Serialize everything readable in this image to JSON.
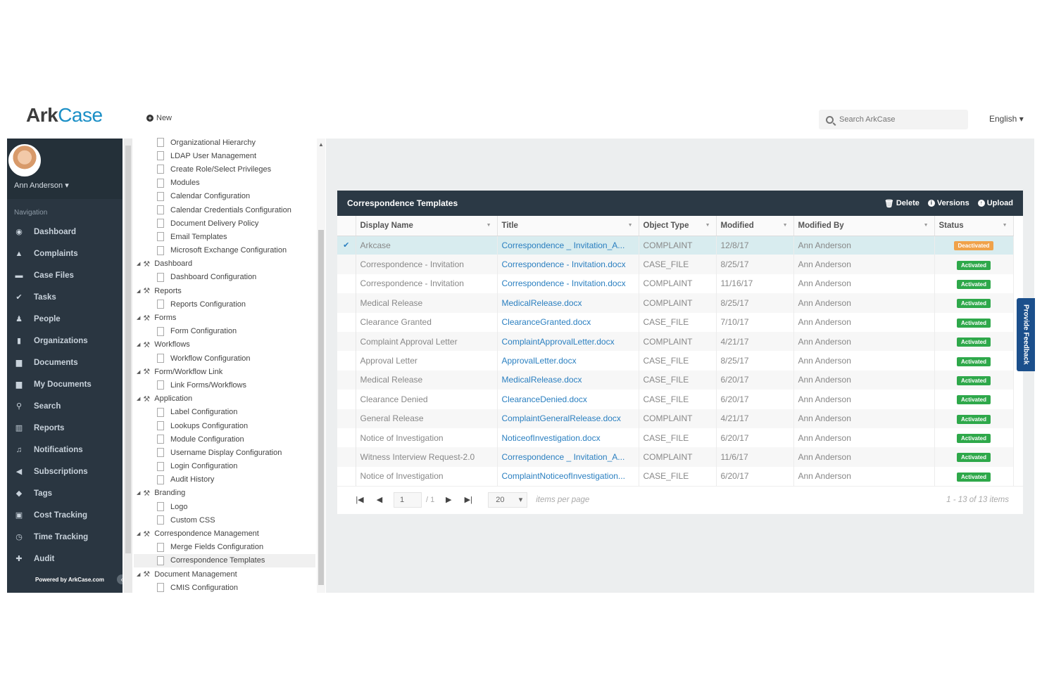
{
  "app": {
    "logo_ark": "Ark",
    "logo_case": "Case",
    "new_label": "New",
    "search_placeholder": "Search ArkCase",
    "language": "English"
  },
  "sidebar": {
    "user_name": "Ann Anderson",
    "nav_title": "Navigation",
    "items": [
      {
        "label": "Dashboard",
        "icon": "dashboard-icon",
        "glyph": "◉"
      },
      {
        "label": "Complaints",
        "icon": "warning-icon",
        "glyph": "▲"
      },
      {
        "label": "Case Files",
        "icon": "folder-icon",
        "glyph": "▬"
      },
      {
        "label": "Tasks",
        "icon": "check-circle-icon",
        "glyph": "✔"
      },
      {
        "label": "People",
        "icon": "person-icon",
        "glyph": "♟"
      },
      {
        "label": "Organizations",
        "icon": "building-icon",
        "glyph": "▮"
      },
      {
        "label": "Documents",
        "icon": "document-icon",
        "glyph": "▆"
      },
      {
        "label": "My Documents",
        "icon": "my-document-icon",
        "glyph": "▆"
      },
      {
        "label": "Search",
        "icon": "search-icon",
        "glyph": "⚲"
      },
      {
        "label": "Reports",
        "icon": "bar-chart-icon",
        "glyph": "▥"
      },
      {
        "label": "Notifications",
        "icon": "bell-icon",
        "glyph": "♫"
      },
      {
        "label": "Subscriptions",
        "icon": "bullhorn-icon",
        "glyph": "◀"
      },
      {
        "label": "Tags",
        "icon": "tag-icon",
        "glyph": "◆"
      },
      {
        "label": "Cost Tracking",
        "icon": "money-icon",
        "glyph": "▣"
      },
      {
        "label": "Time Tracking",
        "icon": "clock-icon",
        "glyph": "◷"
      },
      {
        "label": "Audit",
        "icon": "audit-icon",
        "glyph": "✚"
      }
    ],
    "powered_by": "Powered by ArkCase.com"
  },
  "tree": [
    {
      "type": "child",
      "label": "Organizational Hierarchy"
    },
    {
      "type": "child",
      "label": "LDAP User Management"
    },
    {
      "type": "child",
      "label": "Create Role/Select Privileges"
    },
    {
      "type": "child",
      "label": "Modules"
    },
    {
      "type": "child",
      "label": "Calendar Configuration"
    },
    {
      "type": "child",
      "label": "Calendar Credentials Configuration"
    },
    {
      "type": "child",
      "label": "Document Delivery Policy"
    },
    {
      "type": "child",
      "label": "Email Templates"
    },
    {
      "type": "child",
      "label": "Microsoft Exchange Configuration"
    },
    {
      "type": "parent",
      "label": "Dashboard"
    },
    {
      "type": "child",
      "label": "Dashboard Configuration"
    },
    {
      "type": "parent",
      "label": "Reports"
    },
    {
      "type": "child",
      "label": "Reports Configuration"
    },
    {
      "type": "parent",
      "label": "Forms"
    },
    {
      "type": "child",
      "label": "Form Configuration"
    },
    {
      "type": "parent",
      "label": "Workflows"
    },
    {
      "type": "child",
      "label": "Workflow Configuration"
    },
    {
      "type": "parent",
      "label": "Form/Workflow Link"
    },
    {
      "type": "child",
      "label": "Link Forms/Workflows"
    },
    {
      "type": "parent",
      "label": "Application"
    },
    {
      "type": "child",
      "label": "Label Configuration"
    },
    {
      "type": "child",
      "label": "Lookups Configuration"
    },
    {
      "type": "child",
      "label": "Module Configuration"
    },
    {
      "type": "child",
      "label": "Username Display Configuration"
    },
    {
      "type": "child",
      "label": "Login Configuration"
    },
    {
      "type": "child",
      "label": "Audit History"
    },
    {
      "type": "parent",
      "label": "Branding"
    },
    {
      "type": "child",
      "label": "Logo"
    },
    {
      "type": "child",
      "label": "Custom CSS"
    },
    {
      "type": "parent",
      "label": "Correspondence Management"
    },
    {
      "type": "child",
      "label": "Merge Fields Configuration"
    },
    {
      "type": "child",
      "label": "Correspondence Templates",
      "selected": true
    },
    {
      "type": "parent",
      "label": "Document Management"
    },
    {
      "type": "child",
      "label": "CMIS Configuration"
    }
  ],
  "panel": {
    "title": "Correspondence Templates",
    "actions": {
      "delete": "Delete",
      "versions": "Versions",
      "upload": "Upload"
    },
    "columns": [
      "Display Name",
      "Title",
      "Object Type",
      "Modified",
      "Modified By",
      "Status"
    ],
    "rows": [
      {
        "name": "Arkcase",
        "title": "Correspondence _ Invitation_A...",
        "type": "COMPLAINT",
        "modified": "12/8/17",
        "by": "Ann Anderson",
        "status": "Deactivated",
        "active": true
      },
      {
        "name": "Correspondence - Invitation",
        "title": "Correspondence - Invitation.docx",
        "type": "CASE_FILE",
        "modified": "8/25/17",
        "by": "Ann Anderson",
        "status": "Activated"
      },
      {
        "name": "Correspondence - Invitation",
        "title": "Correspondence - Invitation.docx",
        "type": "COMPLAINT",
        "modified": "11/16/17",
        "by": "Ann Anderson",
        "status": "Activated"
      },
      {
        "name": "Medical Release",
        "title": "MedicalRelease.docx",
        "type": "COMPLAINT",
        "modified": "8/25/17",
        "by": "Ann Anderson",
        "status": "Activated"
      },
      {
        "name": "Clearance Granted",
        "title": "ClearanceGranted.docx",
        "type": "CASE_FILE",
        "modified": "7/10/17",
        "by": "Ann Anderson",
        "status": "Activated"
      },
      {
        "name": "Complaint Approval Letter",
        "title": "ComplaintApprovalLetter.docx",
        "type": "COMPLAINT",
        "modified": "4/21/17",
        "by": "Ann Anderson",
        "status": "Activated"
      },
      {
        "name": "Approval Letter",
        "title": "ApprovalLetter.docx",
        "type": "CASE_FILE",
        "modified": "8/25/17",
        "by": "Ann Anderson",
        "status": "Activated"
      },
      {
        "name": "Medical Release",
        "title": "MedicalRelease.docx",
        "type": "CASE_FILE",
        "modified": "6/20/17",
        "by": "Ann Anderson",
        "status": "Activated"
      },
      {
        "name": "Clearance Denied",
        "title": "ClearanceDenied.docx",
        "type": "CASE_FILE",
        "modified": "6/20/17",
        "by": "Ann Anderson",
        "status": "Activated"
      },
      {
        "name": "General Release",
        "title": "ComplaintGeneralRelease.docx",
        "type": "COMPLAINT",
        "modified": "4/21/17",
        "by": "Ann Anderson",
        "status": "Activated"
      },
      {
        "name": "Notice of Investigation",
        "title": "NoticeofInvestigation.docx",
        "type": "CASE_FILE",
        "modified": "6/20/17",
        "by": "Ann Anderson",
        "status": "Activated"
      },
      {
        "name": "Witness Interview Request-2.0",
        "title": "Correspondence _ Invitation_A...",
        "type": "COMPLAINT",
        "modified": "11/6/17",
        "by": "Ann Anderson",
        "status": "Activated"
      },
      {
        "name": "Notice of Investigation",
        "title": "ComplaintNoticeofInvestigation...",
        "type": "CASE_FILE",
        "modified": "6/20/17",
        "by": "Ann Anderson",
        "status": "Activated"
      }
    ],
    "pager": {
      "page": "1",
      "of": "/ 1",
      "page_size": "20",
      "items_per_page": "items per page",
      "count": "1 - 13 of 13 items"
    }
  },
  "feedback_label": "Provide Feedback"
}
